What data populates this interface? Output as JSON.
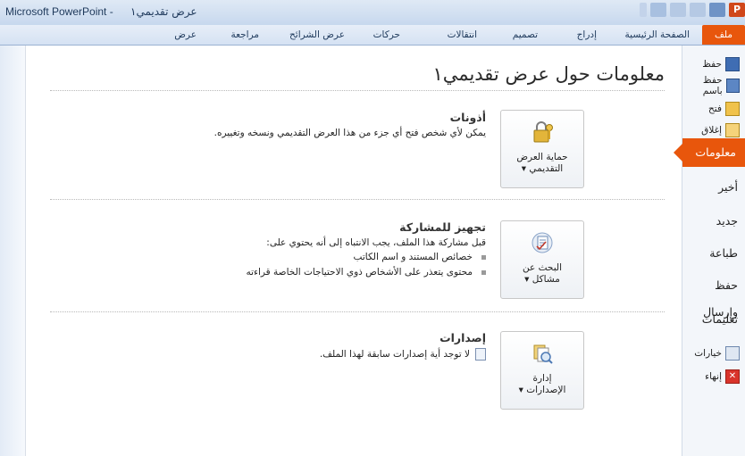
{
  "window": {
    "app_title": "Microsoft PowerPoint -",
    "doc_title": "عرض تقديمي١"
  },
  "tabs": [
    {
      "label": "ملف"
    },
    {
      "label": "الصفحة الرئيسية"
    },
    {
      "label": "إدراج"
    },
    {
      "label": "تصميم"
    },
    {
      "label": "انتقالات"
    },
    {
      "label": "حركات"
    },
    {
      "label": "عرض الشرائح"
    },
    {
      "label": "مراجعة"
    },
    {
      "label": "عرض"
    }
  ],
  "nav": {
    "save": "حفظ",
    "save_as": "حفظ باسم",
    "open": "فتح",
    "close": "إغلاق",
    "info": "معلومات",
    "recent": "أخير",
    "new": "جديد",
    "print": "طباعة",
    "save_send": "حفظ وإرسال",
    "help": "تعليمات",
    "options": "خيارات",
    "exit": "إنهاء"
  },
  "page": {
    "title": "معلومات حول عرض تقديمي١"
  },
  "permissions": {
    "button_line1": "حماية العرض",
    "button_line2": "التقديمي ▾",
    "heading": "أذونات",
    "text": "يمكن لأي شخص فتح أي جزء من هذا العرض التقديمي ونسخه وتغييره."
  },
  "prepare": {
    "button_line1": "البحث عن",
    "button_line2": "مشاكل ▾",
    "heading": "تجهيز للمشاركة",
    "text": "قبل مشاركة هذا الملف، يجب الانتباه إلى أنه يحتوي على:",
    "bullets": [
      "خصائص المستند و اسم الكاتب",
      "محتوى يتعذر على الأشخاص ذوي الاحتياجات الخاصة قراءته"
    ]
  },
  "versions": {
    "button_line1": "إدارة",
    "button_line2": "الإصدارات ▾",
    "heading": "إصدارات",
    "text": "لا توجد أية إصدارات سابقة لهذا الملف."
  },
  "colors": {
    "accent": "#e8560c",
    "ribbon": "#d5e2f3"
  }
}
